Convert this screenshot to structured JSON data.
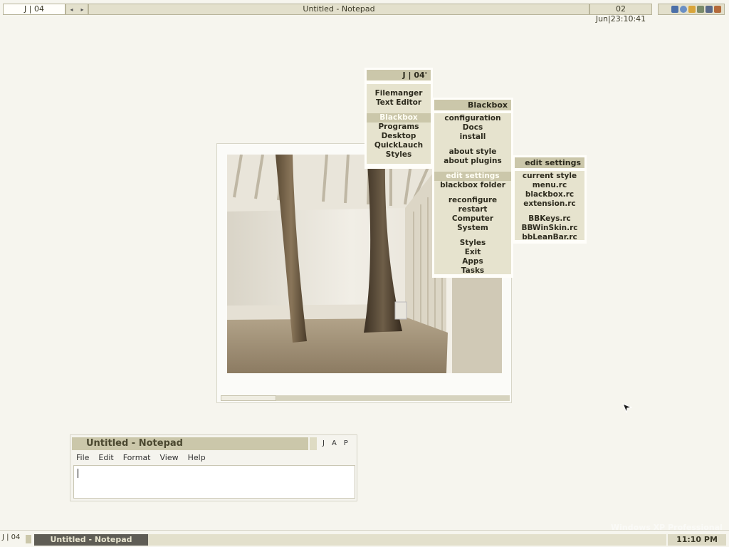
{
  "top_bar": {
    "workspace_label": "J | 04",
    "prev_arrow": "◂",
    "next_arrow": "▸",
    "window_title": "Untitled - Notepad",
    "clock": "02 Jun|23:10:41",
    "tray_icons": [
      "monitor-icon",
      "globe-icon",
      "palette-icon",
      "shield-icon",
      "disk-icon",
      "speaker-icon"
    ]
  },
  "root_menu": {
    "title": "J | 04'",
    "items": [
      "Filemanger",
      "Text Editor",
      "Blackbox",
      "Programs",
      "Desktop",
      "QuickLauch",
      "Styles"
    ],
    "selected": "Blackbox"
  },
  "blackbox_menu": {
    "title": "Blackbox",
    "items": [
      "configuration",
      "Docs",
      "install",
      "about style",
      "about plugins",
      "edit settings",
      "blackbox folder",
      "reconfigure",
      "restart",
      "Computer",
      "System",
      "Styles",
      "Exit",
      "Apps",
      "Tasks"
    ],
    "selected": "edit settings"
  },
  "edit_settings_menu": {
    "title": "edit settings",
    "items": [
      "current style",
      "menu.rc",
      "blackbox.rc",
      "extension.rc",
      "BBKeys.rc",
      "BBWinSkin.rc",
      "bbLeanBar.rc"
    ]
  },
  "notepad": {
    "title": "Untitled - Notepad",
    "buttons": [
      "J",
      "A",
      "P"
    ],
    "menu": [
      "File",
      "Edit",
      "Format",
      "View",
      "Help"
    ],
    "content": ""
  },
  "bottom_bar": {
    "workspace_label": "J | 04",
    "active_task": "Untitled - Notepad",
    "clock": "11:10 PM"
  },
  "watermark": "Windows XP Professional",
  "colors": {
    "desktop": "#f6f5ee",
    "accent": "#cbc7aa",
    "menu_body": "#e6e3ce",
    "task_active": "#5f5d55"
  }
}
